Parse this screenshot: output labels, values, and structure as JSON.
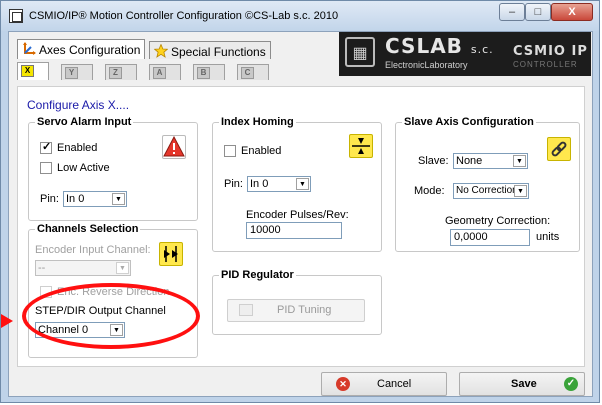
{
  "window": {
    "title": "CSMIO/IP® Motion Controller Configuration    ©CS-Lab s.c. 2010",
    "minimize": "–",
    "maximize": "□",
    "close": "X"
  },
  "tabs": [
    {
      "label": "Axes Configuration",
      "icon": "axes-icon",
      "active": true
    },
    {
      "label": "Special Functions",
      "icon": "star-icon",
      "active": false
    }
  ],
  "axis_tabs": [
    "X",
    "Y",
    "Z",
    "A",
    "B",
    "C"
  ],
  "logo": {
    "brand": "CSLAB",
    "brand_suffix": "s.c.",
    "subtitle": "ElectronicLaboratory",
    "product": "CSMIO IP",
    "product_sub": "CONTROLLER"
  },
  "caption": "Configure Axis X....",
  "servo_alarm": {
    "title": "Servo Alarm Input",
    "enabled_label": "Enabled",
    "enabled": true,
    "low_active_label": "Low Active",
    "low_active": false,
    "pin_label": "Pin:",
    "pin_value": "In 0"
  },
  "index_homing": {
    "title": "Index Homing",
    "enabled_label": "Enabled",
    "enabled": false,
    "pin_label": "Pin:",
    "pin_value": "In 0",
    "pulses_label": "Encoder Pulses/Rev:",
    "pulses_value": "10000"
  },
  "slave_axis": {
    "title": "Slave Axis Configuration",
    "slave_label": "Slave:",
    "slave_value": "None",
    "mode_label": "Mode:",
    "mode_value": "No Correction",
    "geometry_label": "Geometry Correction:",
    "geometry_value": "0,0000",
    "units_label": "units"
  },
  "channels": {
    "title": "Channels Selection",
    "encoder_label": "Encoder Input Channel:",
    "encoder_value": "--",
    "reverse_label": "Enc. Reverse Direction",
    "step_dir_label": "STEP/DIR Output Channel",
    "step_dir_value": "Channel 0"
  },
  "pid": {
    "title": "PID Regulator",
    "button_label": "PID Tuning"
  },
  "footer": {
    "cancel_label": "Cancel",
    "save_label": "Save"
  },
  "colors": {
    "highlight": "#ff1010",
    "caption": "#1a1aa8",
    "axis_active": "#f5e600"
  }
}
